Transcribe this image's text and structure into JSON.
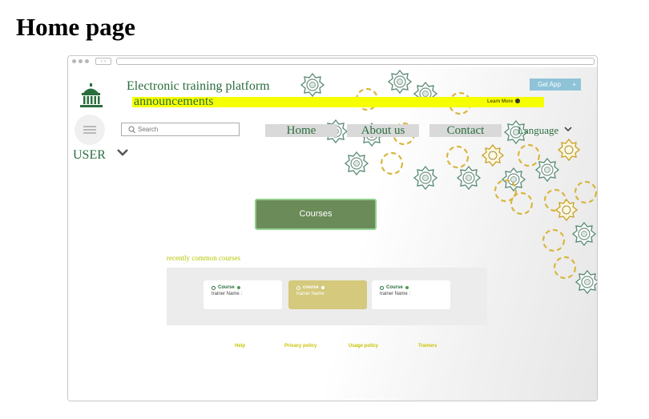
{
  "heading": "Home page",
  "site": {
    "title": "Electronic training platform",
    "announcement": "announcements",
    "learn_more": "Learn More",
    "get_app": "Get App",
    "get_app_icon": "+"
  },
  "nav": {
    "user_label": "USER",
    "search_placeholder": "Search",
    "home": "Home",
    "about": "About us",
    "contact": "Contact",
    "language": "Language"
  },
  "main": {
    "courses_button": "Courses",
    "recent_label": "recently common courses",
    "cards": [
      {
        "title": "Course",
        "trainer": "trainer Name :"
      },
      {
        "title": "course",
        "trainer": "trainer Name :"
      },
      {
        "title": "Course",
        "trainer": "trainer Name :"
      }
    ]
  },
  "footer": {
    "help": "Help",
    "privacy": "Privacy policy",
    "usage": "Usage policy",
    "trainers": "Trainers"
  },
  "colors": {
    "brand_green": "#2a6e3d",
    "highlight_yellow": "#f6ff00",
    "button_green": "#6b8b59",
    "card_highlight": "#d4c97c",
    "get_app_blue": "#8fc3d8"
  }
}
